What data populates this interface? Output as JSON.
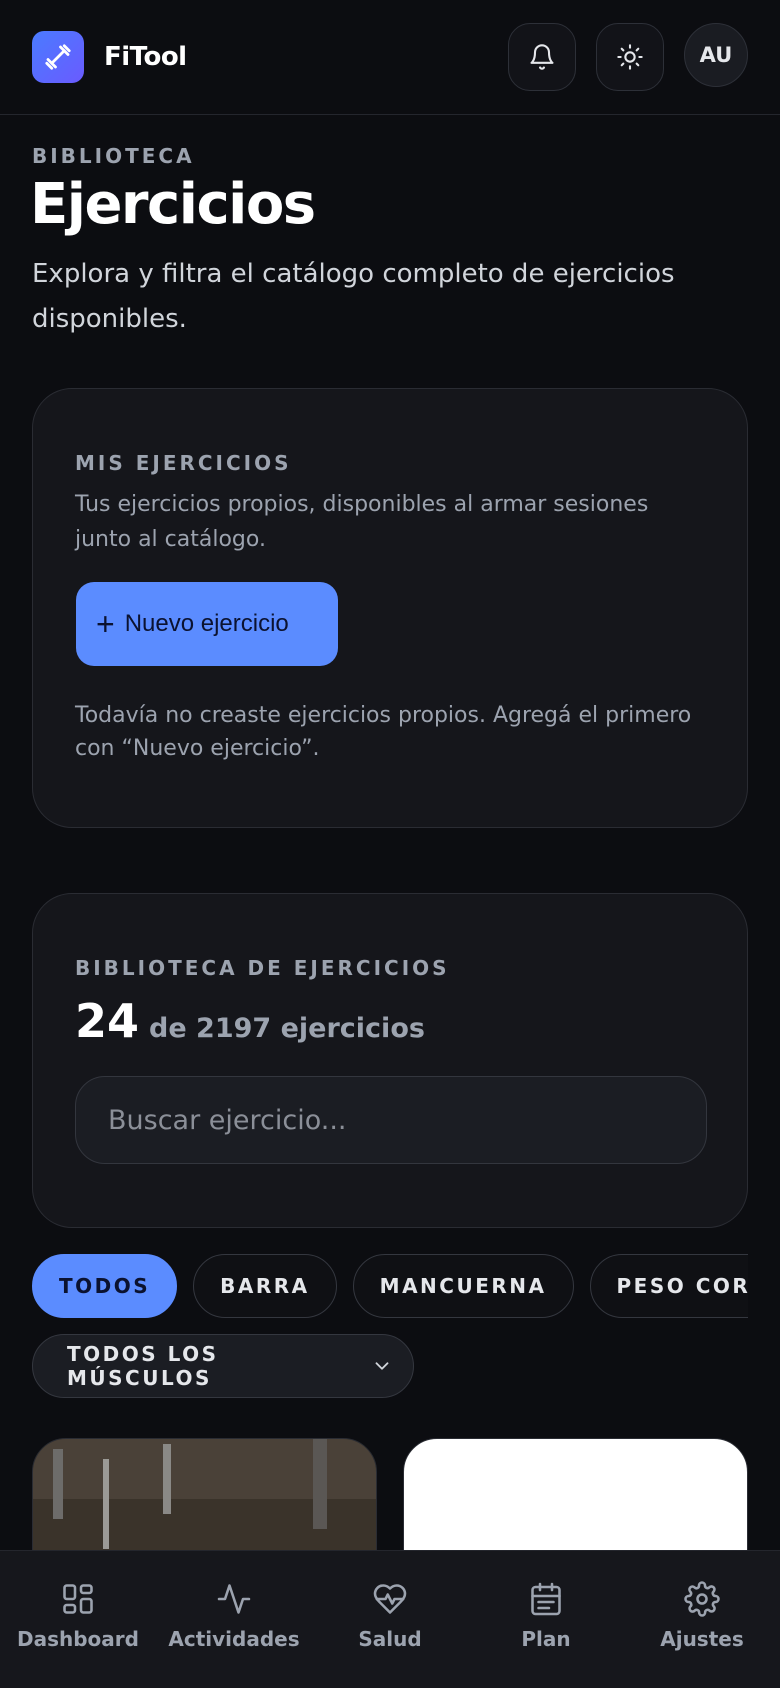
{
  "header": {
    "brand": "FiTool",
    "avatar_initials": "AU",
    "icons": [
      "dumbbell-icon",
      "bell-icon",
      "sun-icon"
    ]
  },
  "page": {
    "overline": "BIBLIOTECA",
    "title": "Ejercicios",
    "description": "Explora y filtra el catálogo completo de ejercicios disponibles."
  },
  "my_exercises": {
    "overline": "MIS EJERCICIOS",
    "description": "Tus ejercicios propios, disponibles al armar sesiones junto al catálogo.",
    "new_button_label": "Nuevo ejercicio",
    "empty_text": "Todavía no creaste ejercicios propios. Agregá el primero con “Nuevo ejercicio”."
  },
  "library": {
    "overline": "BIBLIOTECA DE EJERCICIOS",
    "shown_count": "24",
    "total_text": "de 2197 ejercicios",
    "search_placeholder": "Buscar ejercicio..."
  },
  "filters": {
    "equipment": [
      {
        "label": "TODOS",
        "active": true
      },
      {
        "label": "BARRA",
        "active": false
      },
      {
        "label": "MANCUERNA",
        "active": false
      },
      {
        "label": "PESO CORPORAL",
        "active": false
      }
    ],
    "muscle_select": "TODOS LOS MÚSCULOS"
  },
  "nav": {
    "items": [
      {
        "label": "Dashboard",
        "icon": "dashboard-icon"
      },
      {
        "label": "Actividades",
        "icon": "activity-icon"
      },
      {
        "label": "Salud",
        "icon": "heart-pulse-icon"
      },
      {
        "label": "Plan",
        "icon": "calendar-icon"
      },
      {
        "label": "Ajustes",
        "icon": "gear-icon"
      }
    ]
  },
  "colors": {
    "accent": "#5b8cff",
    "background": "#0c0d11",
    "card": "#15161b"
  }
}
